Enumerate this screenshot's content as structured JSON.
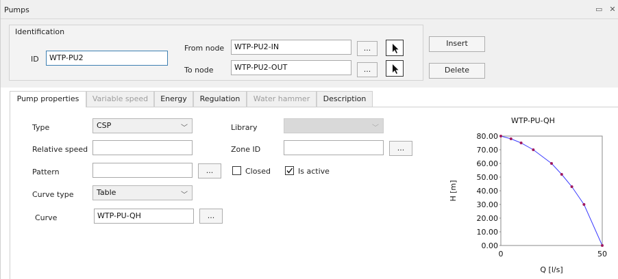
{
  "window": {
    "title": "Pumps"
  },
  "identification": {
    "legend": "Identification",
    "id_label": "ID",
    "id_value": "WTP-PU2",
    "from_node_label": "From node",
    "from_node_value": "WTP-PU2-IN",
    "to_node_label": "To node",
    "to_node_value": "WTP-PU2-OUT",
    "browse_label": "...",
    "insert_label": "Insert",
    "delete_label": "Delete"
  },
  "tabs": [
    {
      "label": "Pump properties",
      "active": true,
      "enabled": true
    },
    {
      "label": "Variable speed",
      "active": false,
      "enabled": false
    },
    {
      "label": "Energy",
      "active": false,
      "enabled": true
    },
    {
      "label": "Regulation",
      "active": false,
      "enabled": true
    },
    {
      "label": "Water hammer",
      "active": false,
      "enabled": false
    },
    {
      "label": "Description",
      "active": false,
      "enabled": true
    }
  ],
  "properties": {
    "type_label": "Type",
    "type_value": "CSP",
    "relative_speed_label": "Relative speed",
    "relative_speed_value": "",
    "pattern_label": "Pattern",
    "pattern_value": "",
    "curve_type_label": "Curve type",
    "curve_type_value": "Table",
    "curve_label": "Curve",
    "curve_value": "WTP-PU-QH",
    "library_label": "Library",
    "library_value": "",
    "zone_id_label": "Zone ID",
    "zone_id_value": "",
    "closed_label": "Closed",
    "closed_checked": false,
    "is_active_label": "Is active",
    "is_active_checked": true,
    "browse_label": "..."
  },
  "colors": {
    "line": "#3a3aff",
    "marker": "#a0195f",
    "accent": "#3c7fb1"
  },
  "chart_data": {
    "type": "line",
    "title": "WTP-PU-QH",
    "xlabel": "Q [l/s]",
    "ylabel": "H [m]",
    "xlim": [
      0,
      50
    ],
    "ylim": [
      0,
      80
    ],
    "x_ticks": [
      "0",
      "50"
    ],
    "y_ticks": [
      "0.00",
      "10.00",
      "20.00",
      "30.00",
      "40.00",
      "50.00",
      "60.00",
      "70.00",
      "80.00"
    ],
    "grid": false,
    "series": [
      {
        "x": [
          0,
          5,
          10,
          16,
          25,
          30,
          35,
          41,
          50
        ],
        "y": [
          80,
          78,
          75,
          70,
          60,
          52,
          43,
          30,
          0
        ]
      }
    ]
  }
}
